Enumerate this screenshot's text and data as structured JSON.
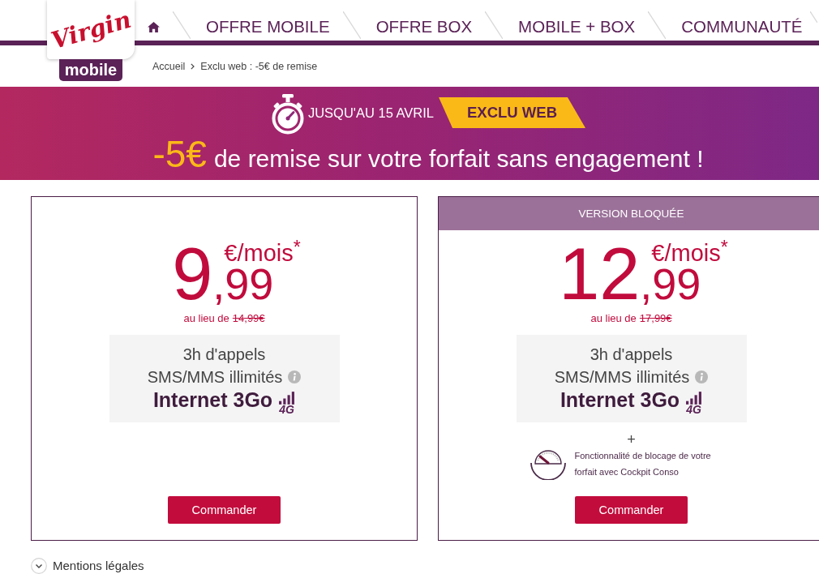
{
  "header": {
    "logo": {
      "wordmark": "Virgin",
      "tag": "mobile"
    },
    "nav": [
      {
        "kind": "home"
      },
      {
        "kind": "link",
        "label": "OFFRE MOBILE"
      },
      {
        "kind": "link",
        "label": "OFFRE BOX"
      },
      {
        "kind": "link",
        "label": "MOBILE + BOX"
      },
      {
        "kind": "link",
        "label": "COMMUNAUTÉ"
      }
    ]
  },
  "breadcrumb": [
    "Accueil",
    "Exclu web : -5€ de remise"
  ],
  "banner": {
    "deadline": "JUSQU'AU 15 AVRIL",
    "badge": "EXCLU WEB",
    "discount": "-5€",
    "headline": "de remise sur votre forfait sans engagement !"
  },
  "offers": [
    {
      "price": "9",
      "cents": ",99",
      "unit": "€/mois$^{*}$",
      "was_label": "au lieu de",
      "was_price": "14,99€",
      "features": [
        {
          "kind": "plain",
          "label": "3h d'appels"
        },
        {
          "kind": "info",
          "label": "SMS/MMS illimités"
        },
        {
          "kind": "data",
          "label": "Internet 3Go",
          "network": "4G"
        }
      ],
      "button": "Commander"
    },
    {
      "tag": "VERSION BLOQUÉE",
      "price": "12",
      "cents": ",99",
      "unit": "€/mois$^{*}$",
      "was_label": "au lieu de",
      "was_price": "17,99€",
      "features": [
        {
          "kind": "plain",
          "label": "3h d'appels"
        },
        {
          "kind": "info",
          "label": "SMS/MMS illimités"
        },
        {
          "kind": "data",
          "label": "Internet 3Go",
          "network": "4G"
        }
      ],
      "extra": {
        "plus": "+",
        "text": "Fonctionnalité de blocage de votre forfait avec Cockpit Conso"
      },
      "button": "Commander"
    }
  ],
  "footer": {
    "legal": {
      "label": "Mentions légales",
      "expanded": false
    }
  }
}
